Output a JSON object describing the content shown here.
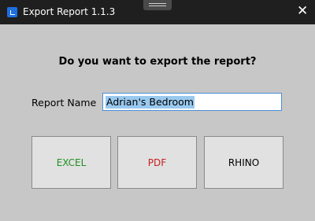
{
  "window": {
    "title": "Export Report 1.1.3",
    "app_icon": "app-icon",
    "close_icon": "close-icon",
    "close_glyph": "✕"
  },
  "dialog": {
    "prompt": "Do you want to export the report?",
    "report_name_label": "Report Name",
    "report_name_value": "Adrian's Bedroom"
  },
  "buttons": {
    "excel": {
      "label": "EXCEL",
      "color": "#1f8f1f"
    },
    "pdf": {
      "label": "PDF",
      "color": "#c81e1e"
    },
    "rhino": {
      "label": "RHINO",
      "color": "#000000"
    }
  },
  "colors": {
    "titlebar": "#1f1f1f",
    "background": "#c7c7c7",
    "selection": "#99c9ef",
    "input_border": "#4a8fd8"
  }
}
